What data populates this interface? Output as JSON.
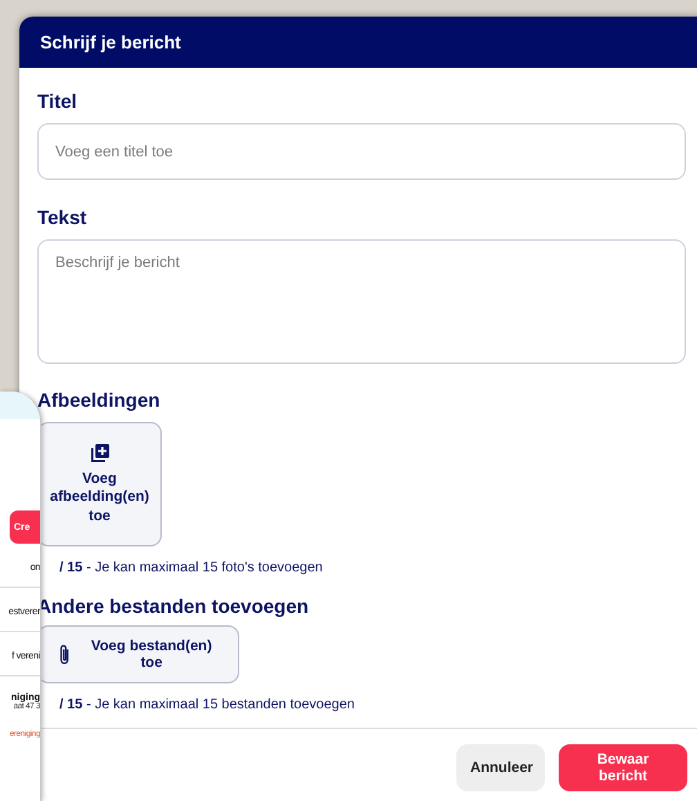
{
  "dialog": {
    "title": "Schrijf je bericht",
    "fields": [
      {
        "label": "Titel",
        "kind": "input",
        "placeholder": "Voeg een titel toe"
      },
      {
        "label": "Tekst",
        "kind": "textarea",
        "placeholder": "Beschrijf je bericht"
      }
    ],
    "images": {
      "label": "Afbeeldingen",
      "button": "Voeg afbeelding(en) toe",
      "count": "**/ 15** - Je kan maximaal 15 foto's toevoegen"
    },
    "files": {
      "label": "Andere bestanden toevoegen",
      "button": "Voeg bestand(en) toe",
      "count": "**/ 15** - Je kan maximaal 15 bestanden toevoegen"
    },
    "buttons": [
      {
        "label": "Annuleer",
        "kind": "secondary"
      },
      {
        "label": "Bewaar bericht",
        "kind": "primary"
      }
    ]
  },
  "background_panel": {
    "button": "Cre",
    "rows": [
      {
        "kind": "text",
        "text": "on"
      },
      {
        "kind": "text",
        "text": "estverer"
      },
      {
        "kind": "text",
        "text": "f vereni"
      },
      {
        "kind": "title",
        "text": "niging",
        "sub": "aat 47 3"
      },
      {
        "kind": "tag",
        "text": "ereniging"
      }
    ]
  }
}
